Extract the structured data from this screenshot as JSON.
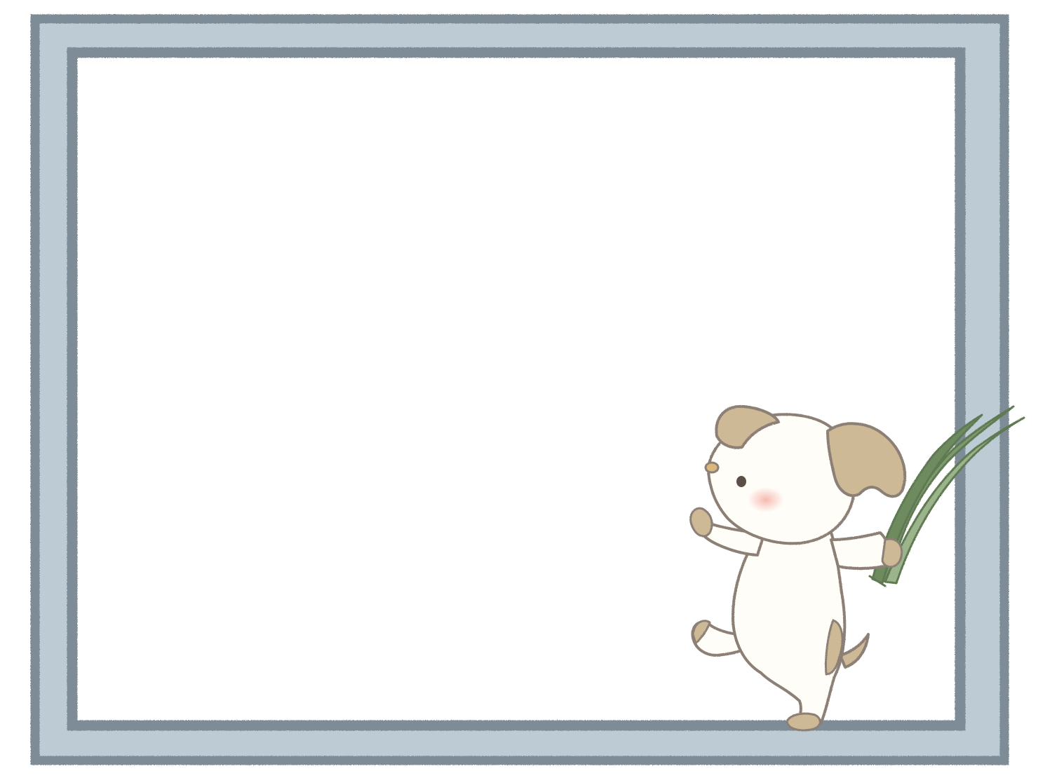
{
  "colors": {
    "background": "#ffffff",
    "frame_outer_border": "#7d8c96",
    "frame_fill": "#bccbd4",
    "frame_inner_border": "#7d8c96",
    "content_fill": "#ffffff",
    "puppy_body": "#fffdf8",
    "puppy_outline": "#8c7f76",
    "puppy_patch": "#cdb995",
    "puppy_cheek": "#f6b7ad",
    "puppy_eye": "#5b4f48",
    "grass_dark": "#6e8a5f",
    "grass_light": "#9cb48b"
  },
  "decoration": {
    "character_icon": "puppy-holding-grass-icon",
    "frame_icon": "double-border-frame"
  },
  "content": {
    "text": ""
  }
}
